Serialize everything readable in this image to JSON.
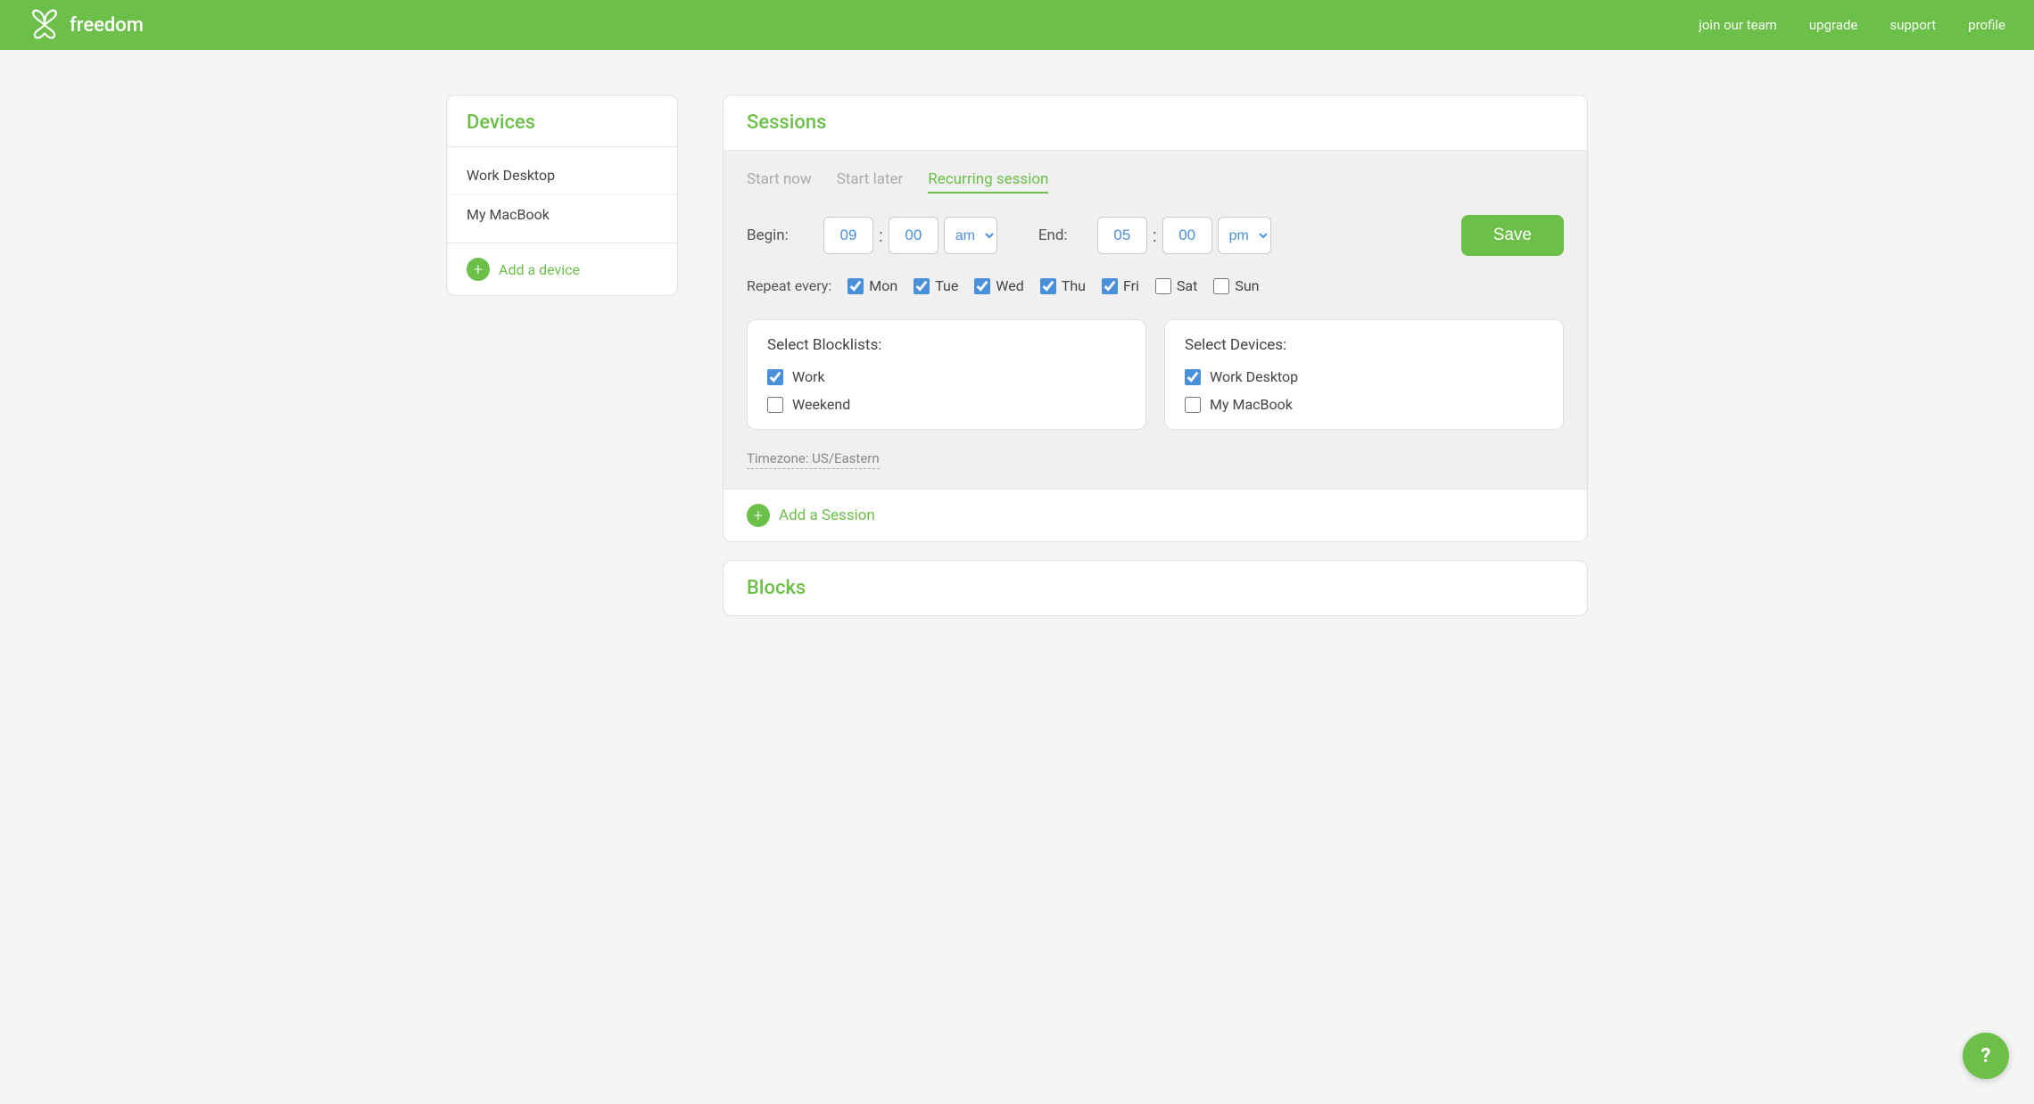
{
  "header": {
    "logo_text": "freedom",
    "nav": {
      "join": "join our team",
      "upgrade": "upgrade",
      "support": "support",
      "profile": "profile"
    }
  },
  "sidebar": {
    "title": "Devices",
    "devices": [
      "Work Desktop",
      "My MacBook"
    ],
    "add_label": "Add a device"
  },
  "sessions": {
    "panel_title": "Sessions",
    "tabs": [
      {
        "label": "Start now",
        "active": false
      },
      {
        "label": "Start later",
        "active": false
      },
      {
        "label": "Recurring session",
        "active": true
      }
    ],
    "begin": {
      "label": "Begin:",
      "hour": "09",
      "minute": "00",
      "ampm": "am"
    },
    "end": {
      "label": "End:",
      "hour": "05",
      "minute": "00",
      "ampm": "pm"
    },
    "save_label": "Save",
    "repeat_label": "Repeat every:",
    "days": [
      {
        "label": "Mon",
        "checked": true
      },
      {
        "label": "Tue",
        "checked": true
      },
      {
        "label": "Wed",
        "checked": true
      },
      {
        "label": "Thu",
        "checked": true
      },
      {
        "label": "Fri",
        "checked": true
      },
      {
        "label": "Sat",
        "checked": false
      },
      {
        "label": "Sun",
        "checked": false
      }
    ],
    "blocklists": {
      "title": "Select Blocklists:",
      "items": [
        {
          "label": "Work",
          "checked": true
        },
        {
          "label": "Weekend",
          "checked": false
        }
      ]
    },
    "select_devices": {
      "title": "Select Devices:",
      "items": [
        {
          "label": "Work Desktop",
          "checked": true
        },
        {
          "label": "My MacBook",
          "checked": false
        }
      ]
    },
    "timezone": "Timezone: US/Eastern",
    "add_session_label": "Add a Session"
  },
  "blocks": {
    "title": "Blocks"
  },
  "help": {
    "icon": "?"
  }
}
